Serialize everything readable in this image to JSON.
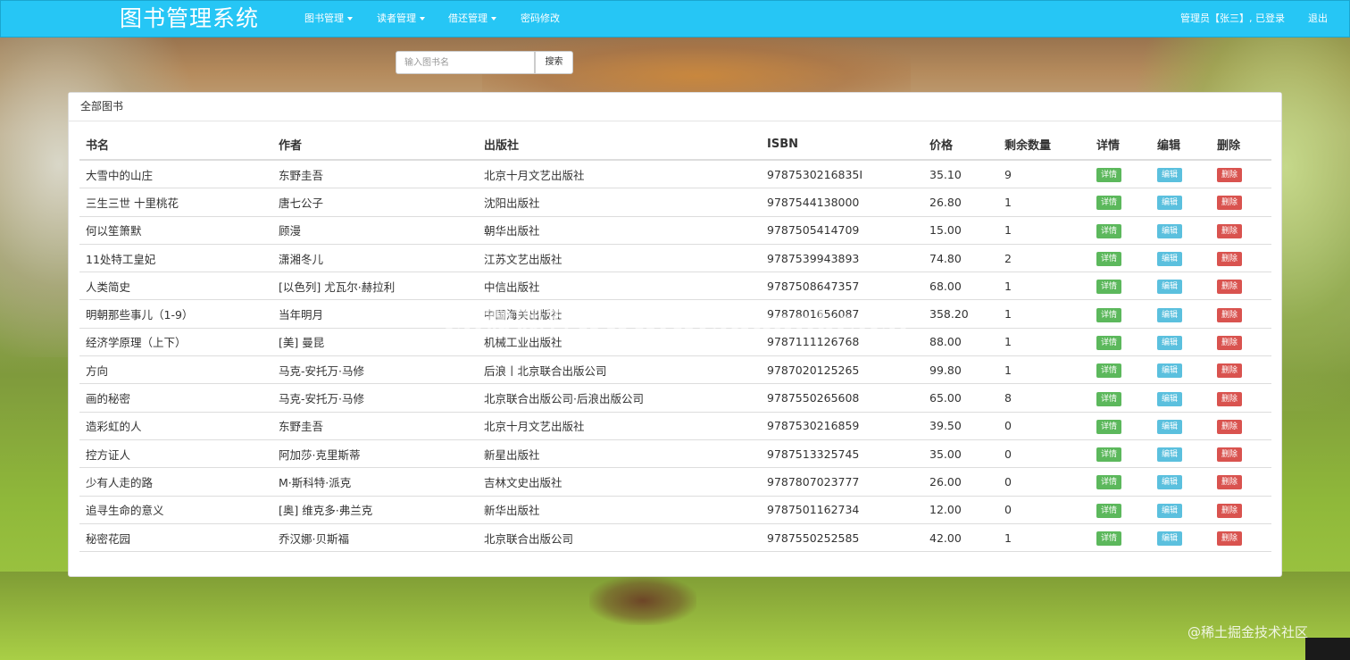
{
  "app": {
    "title": "图书管理系统"
  },
  "nav": {
    "items": [
      {
        "label": "图书管理",
        "dropdown": true
      },
      {
        "label": "读者管理",
        "dropdown": true
      },
      {
        "label": "借还管理",
        "dropdown": true
      },
      {
        "label": "密码修改",
        "dropdown": false
      }
    ],
    "user_status": "管理员【张三】, 已登录",
    "logout": "退出"
  },
  "search": {
    "placeholder": "输入图书名",
    "button": "搜索"
  },
  "panel": {
    "title": "全部图书"
  },
  "table": {
    "headers": [
      "书名",
      "作者",
      "出版社",
      "ISBN",
      "价格",
      "剩余数量",
      "详情",
      "编辑",
      "删除"
    ],
    "action_labels": {
      "detail": "详情",
      "edit": "编辑",
      "delete": "删除"
    },
    "rows": [
      {
        "title": "大雪中的山庄",
        "author": "东野圭吾",
        "publisher": "北京十月文艺出版社",
        "isbn": "9787530216835I",
        "price": "35.10",
        "stock": "9"
      },
      {
        "title": "三生三世 十里桃花",
        "author": "唐七公子",
        "publisher": "沈阳出版社",
        "isbn": "9787544138000",
        "price": "26.80",
        "stock": "1"
      },
      {
        "title": "何以笙箫默",
        "author": "顾漫",
        "publisher": "朝华出版社",
        "isbn": "9787505414709",
        "price": "15.00",
        "stock": "1"
      },
      {
        "title": "11处特工皇妃",
        "author": "潇湘冬儿",
        "publisher": "江苏文艺出版社",
        "isbn": "9787539943893",
        "price": "74.80",
        "stock": "2"
      },
      {
        "title": "人类简史",
        "author": "[以色列] 尤瓦尔·赫拉利",
        "publisher": "中信出版社",
        "isbn": "9787508647357",
        "price": "68.00",
        "stock": "1"
      },
      {
        "title": "明朝那些事儿（1-9）",
        "author": "当年明月",
        "publisher": "中国海关出版社",
        "isbn": "9787801656087",
        "price": "358.20",
        "stock": "1"
      },
      {
        "title": "经济学原理（上下）",
        "author": "[美] 曼昆",
        "publisher": "机械工业出版社",
        "isbn": "9787111126768",
        "price": "88.00",
        "stock": "1"
      },
      {
        "title": "方向",
        "author": "马克-安托万·马修",
        "publisher": "后浪丨北京联合出版公司",
        "isbn": "9787020125265",
        "price": "99.80",
        "stock": "1"
      },
      {
        "title": "画的秘密",
        "author": "马克-安托万·马修",
        "publisher": "北京联合出版公司·后浪出版公司",
        "isbn": "9787550265608",
        "price": "65.00",
        "stock": "8"
      },
      {
        "title": "造彩虹的人",
        "author": "东野圭吾",
        "publisher": "北京十月文艺出版社",
        "isbn": "9787530216859",
        "price": "39.50",
        "stock": "0"
      },
      {
        "title": "控方证人",
        "author": "阿加莎·克里斯蒂",
        "publisher": "新星出版社",
        "isbn": "9787513325745",
        "price": "35.00",
        "stock": "0"
      },
      {
        "title": "少有人走的路",
        "author": "M·斯科特·派克",
        "publisher": "吉林文史出版社",
        "isbn": "9787807023777",
        "price": "26.00",
        "stock": "0"
      },
      {
        "title": "追寻生命的意义",
        "author": "[奥] 维克多·弗兰克",
        "publisher": "新华出版社",
        "isbn": "9787501162734",
        "price": "12.00",
        "stock": "0"
      },
      {
        "title": "秘密花园",
        "author": "乔汉娜·贝斯福",
        "publisher": "北京联合出版公司",
        "isbn": "9787550252585",
        "price": "42.00",
        "stock": "1"
      }
    ]
  },
  "watermark": "cn微观客www.weiguanke.cn",
  "footer_mark": "@稀土掘金技术社区",
  "colors": {
    "navbar": "#26c6f5",
    "detail": "#5cb85c",
    "edit": "#5bc0de",
    "delete": "#d9534f"
  }
}
